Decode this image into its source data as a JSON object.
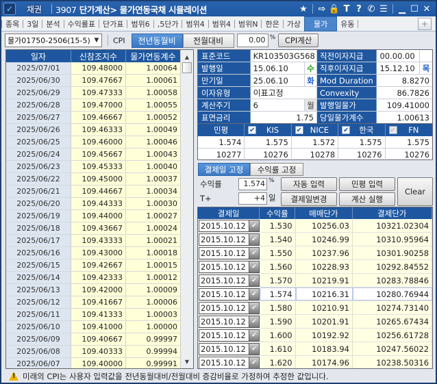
{
  "titlebar": {
    "brand": "채권",
    "screen_no": "3907",
    "title": "단가계산> 물가연동국채 시뮬레이션",
    "icons": [
      "star-icon",
      "export-icon",
      "lock-icon",
      "text-icon",
      "help-icon",
      "phone-icon",
      "list-icon",
      "minimize-icon",
      "maximize-icon",
      "close-icon"
    ],
    "icon_glyphs": [
      "★",
      "⇨",
      "🔒",
      "T",
      "?",
      "✆",
      "☰",
      "▁",
      "☐",
      "✕"
    ]
  },
  "tabs": [
    {
      "label": "종목",
      "active": false
    },
    {
      "label": "3일",
      "active": false
    },
    {
      "label": "분석",
      "active": false
    },
    {
      "label": "수익률표",
      "active": false
    },
    {
      "label": "단가표",
      "active": false
    },
    {
      "label": "범위6",
      "active": false
    },
    {
      "label": ",5단가",
      "active": false
    },
    {
      "label": "범위4",
      "active": false
    },
    {
      "label": "범위4",
      "active": false
    },
    {
      "label": "범위N",
      "active": false
    },
    {
      "label": "한은",
      "active": false
    },
    {
      "label": "가상",
      "active": false
    },
    {
      "label": "물가",
      "active": true
    },
    {
      "label": "유동",
      "active": false
    }
  ],
  "tab_plus": "+",
  "toolbar": {
    "bond_select": "물가01750-2506(15-5)",
    "cpi_label": "CPI",
    "seg_yoy": "전년동월비",
    "seg_mom": "전월대비",
    "rate_value": "0.00",
    "rate_unit": "%",
    "cpi_calc_button": "CPI계산"
  },
  "left_grid": {
    "headers": [
      "일자",
      "신참조지수",
      "물가연동계수"
    ],
    "rows": [
      [
        "2025/07/01",
        "109.48000",
        "1.00064"
      ],
      [
        "2025/06/30",
        "109.47667",
        "1.00061"
      ],
      [
        "2025/06/29",
        "109.47333",
        "1.00058"
      ],
      [
        "2025/06/28",
        "109.47000",
        "1.00055"
      ],
      [
        "2025/06/27",
        "109.46667",
        "1.00052"
      ],
      [
        "2025/06/26",
        "109.46333",
        "1.00049"
      ],
      [
        "2025/06/25",
        "109.46000",
        "1.00046"
      ],
      [
        "2025/06/24",
        "109.45667",
        "1.00043"
      ],
      [
        "2025/06/23",
        "109.45333",
        "1.00040"
      ],
      [
        "2025/06/22",
        "109.45000",
        "1.00037"
      ],
      [
        "2025/06/21",
        "109.44667",
        "1.00034"
      ],
      [
        "2025/06/20",
        "109.44333",
        "1.00030"
      ],
      [
        "2025/06/19",
        "109.44000",
        "1.00027"
      ],
      [
        "2025/06/18",
        "109.43667",
        "1.00024"
      ],
      [
        "2025/06/17",
        "109.43333",
        "1.00021"
      ],
      [
        "2025/06/16",
        "109.43000",
        "1.00018"
      ],
      [
        "2025/06/15",
        "109.42667",
        "1.00015"
      ],
      [
        "2025/06/14",
        "109.42333",
        "1.00012"
      ],
      [
        "2025/06/13",
        "109.42000",
        "1.00009"
      ],
      [
        "2025/06/12",
        "109.41667",
        "1.00006"
      ],
      [
        "2025/06/11",
        "109.41333",
        "1.00003"
      ],
      [
        "2025/06/10",
        "109.41000",
        "1.00000"
      ],
      [
        "2025/06/09",
        "109.40667",
        "0.99997"
      ],
      [
        "2025/06/08",
        "109.40333",
        "0.99994"
      ],
      [
        "2025/06/07",
        "109.40000",
        "0.99991"
      ]
    ]
  },
  "info": {
    "std_code_label": "표준코드",
    "std_code": "KR103503G568",
    "issue_date_label": "발행일",
    "issue_date": "15.06.10",
    "issue_dow": "수",
    "maturity_label": "만기일",
    "maturity": "25.06.10",
    "maturity_dow": "화",
    "interest_type_label": "이자유형",
    "interest_type": "이표고정",
    "calc_period_label": "계산주기",
    "calc_period": "6",
    "calc_period_unit": "월",
    "coupon_label": "표면금리",
    "coupon": "1.75",
    "prev_pay_label": "직전이자지급",
    "prev_pay": "00.00.00",
    "prev_pay_dow": "",
    "next_pay_label": "직후이자지급",
    "next_pay": "15.12.10",
    "next_pay_dow": "목",
    "mod_duration_label": "Mod Duration",
    "mod_duration": "8.8270",
    "convexity_label": "Convexity",
    "convexity": "86.7826",
    "issue_cpi_label": "발행일물가",
    "issue_cpi": "109.41000",
    "today_ratio_label": "당일물가계수",
    "today_ratio": "1.00613"
  },
  "ratings": {
    "headers": [
      "민평",
      "KIS",
      "NICE",
      "한국",
      "FN"
    ],
    "checked": [
      null,
      true,
      true,
      true,
      false
    ],
    "yields": [
      "1.574",
      "1.575",
      "1.572",
      "1.575",
      "1.575"
    ],
    "prices": [
      "10277",
      "10276",
      "10278",
      "10276",
      "10276"
    ]
  },
  "fix_tabs": {
    "settle_fixed": "결제일 고정",
    "yield_fixed": "수익률 고정"
  },
  "calc": {
    "yield_label": "수익률",
    "yield_value": "1.574",
    "yield_unit": "%",
    "t_label": "T+",
    "t_value": "+4",
    "t_unit": "일",
    "auto_input": "자동 입력",
    "mp_input": "민평 입력",
    "change_settle": "결제일변경",
    "run_calc": "계산 실행",
    "clear": "Clear"
  },
  "results": {
    "headers": [
      "결제일",
      "수익률",
      "매매단가",
      "결제단가"
    ],
    "selected_index": 5,
    "rows": [
      [
        "2015.10.12",
        "1.530",
        "10256.03",
        "10321.02304"
      ],
      [
        "2015.10.12",
        "1.540",
        "10246.99",
        "10310.95964"
      ],
      [
        "2015.10.12",
        "1.550",
        "10237.96",
        "10301.90258"
      ],
      [
        "2015.10.12",
        "1.560",
        "10228.93",
        "10292.84552"
      ],
      [
        "2015.10.12",
        "1.570",
        "10219.91",
        "10283.78846"
      ],
      [
        "2015.10.12",
        "1.574",
        "10216.31",
        "10280.76944"
      ],
      [
        "2015.10.12",
        "1.580",
        "10210.91",
        "10274.73140"
      ],
      [
        "2015.10.12",
        "1.590",
        "10201.91",
        "10265.67434"
      ],
      [
        "2015.10.12",
        "1.600",
        "10192.92",
        "10256.61728"
      ],
      [
        "2015.10.12",
        "1.610",
        "10183.94",
        "10247.56022"
      ],
      [
        "2015.10.12",
        "1.620",
        "10174.96",
        "10238.50316"
      ]
    ]
  },
  "status": {
    "message": "미래의 CPI는 사용자 입력값을 전년동월대비/전월대비 증감비율로 가정하여 추정한 값입니다."
  },
  "colors": {
    "header_blue": "#1e57a0",
    "active_tab": "#4b86cc",
    "cell_yellow": "#ffffd8",
    "date_cell": "#dde6f0",
    "wed_green": "#1a9a1a",
    "tue_blue": "#1e5ec8",
    "thu_blue": "#1e5ec8"
  }
}
